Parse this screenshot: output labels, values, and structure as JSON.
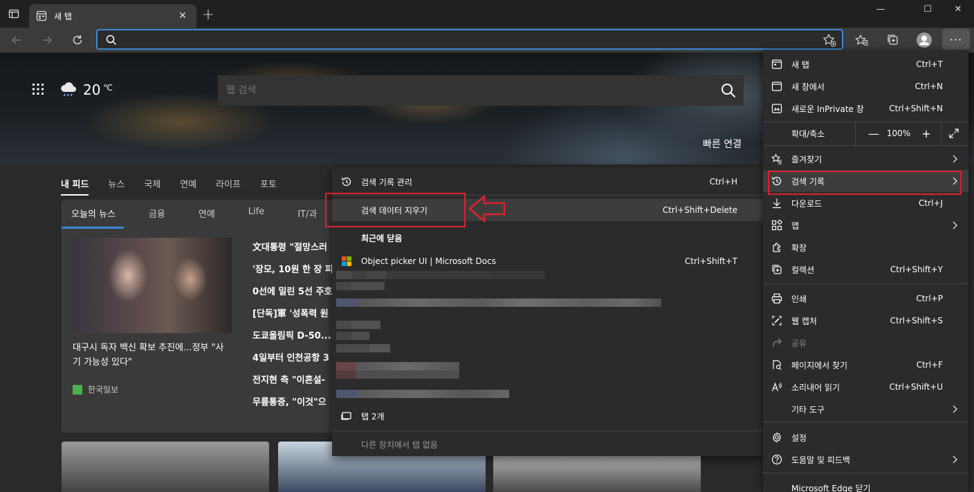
{
  "tab": {
    "title": "새 탭",
    "close": "✕"
  },
  "newtab": "+",
  "window": {
    "minimize": "—",
    "maximize": "☐",
    "close": "✕"
  },
  "address": {
    "value": "",
    "placeholder": ""
  },
  "hero": {
    "temperature": "20",
    "unit": "℃",
    "search_placeholder": "웹 검색",
    "quick_links": "빠른 연결"
  },
  "feed_nav": [
    "내 피드",
    "뉴스",
    "국제",
    "연예",
    "라이프",
    "포토"
  ],
  "news_tabs": [
    "오늘의 뉴스",
    "금융",
    "연예",
    "Life",
    "IT/과"
  ],
  "news": {
    "headline": "대구시 독자 백신 확보 추진에...정부 \"사기 가능성 있다\"",
    "source": "한국일보",
    "side_headlines": [
      "文대통령 \"절망스러",
      "'장모, 10원 한 장 피",
      "0선에 밀린 5선 주호",
      "[단독]軍 '성폭력 원",
      "도쿄올림픽 D-50...",
      "4일부터 인천공항 3",
      "전지현 측 \"이혼설-",
      "무릎통증, \"이것\"으"
    ]
  },
  "menu": {
    "items": [
      {
        "label": "새 탭",
        "shortcut": "Ctrl+T"
      },
      {
        "label": "새 창에서",
        "shortcut": "Ctrl+N"
      },
      {
        "label": "새로운 InPrivate 창",
        "shortcut": "Ctrl+Shift+N"
      }
    ],
    "zoom": {
      "label": "확대/축소",
      "minus": "—",
      "value": "100%",
      "plus": "+"
    },
    "items2": [
      {
        "label": "즐겨찾기",
        "shortcut": ""
      },
      {
        "label": "검색 기록",
        "shortcut": ""
      },
      {
        "label": "다운로드",
        "shortcut": "Ctrl+J"
      },
      {
        "label": "앱",
        "shortcut": ""
      },
      {
        "label": "확장",
        "shortcut": ""
      },
      {
        "label": "컬렉션",
        "shortcut": "Ctrl+Shift+Y"
      }
    ],
    "items3": [
      {
        "label": "인쇄",
        "shortcut": "Ctrl+P"
      },
      {
        "label": "웹 캡처",
        "shortcut": "Ctrl+Shift+S"
      },
      {
        "label": "공유",
        "shortcut": ""
      },
      {
        "label": "페이지에서 찾기",
        "shortcut": "Ctrl+F"
      },
      {
        "label": "소리내어 읽기",
        "shortcut": "Ctrl+Shift+U"
      },
      {
        "label": "기타 도구",
        "shortcut": ""
      }
    ],
    "items4": [
      {
        "label": "설정",
        "shortcut": ""
      },
      {
        "label": "도움말 및 피드백",
        "shortcut": ""
      }
    ],
    "close_label": "Microsoft Edge 닫기"
  },
  "history": {
    "manage": {
      "label": "검색 기록 관리",
      "shortcut": "Ctrl+H"
    },
    "clear": {
      "label": "검색 데이터 지우기",
      "shortcut": "Ctrl+Shift+Delete"
    },
    "recently_closed": "최근에 닫음",
    "closed_item": {
      "label": "Object picker UI | Microsoft Docs",
      "shortcut": "Ctrl+Shift+T"
    },
    "tabs": "탭 2개",
    "no_other_devices": "다른 장치에서 탭 없음"
  },
  "colors": {
    "accent": "#3a8ad9",
    "highlight": "#e0202e",
    "menu_bg": "#2b2b2b"
  }
}
